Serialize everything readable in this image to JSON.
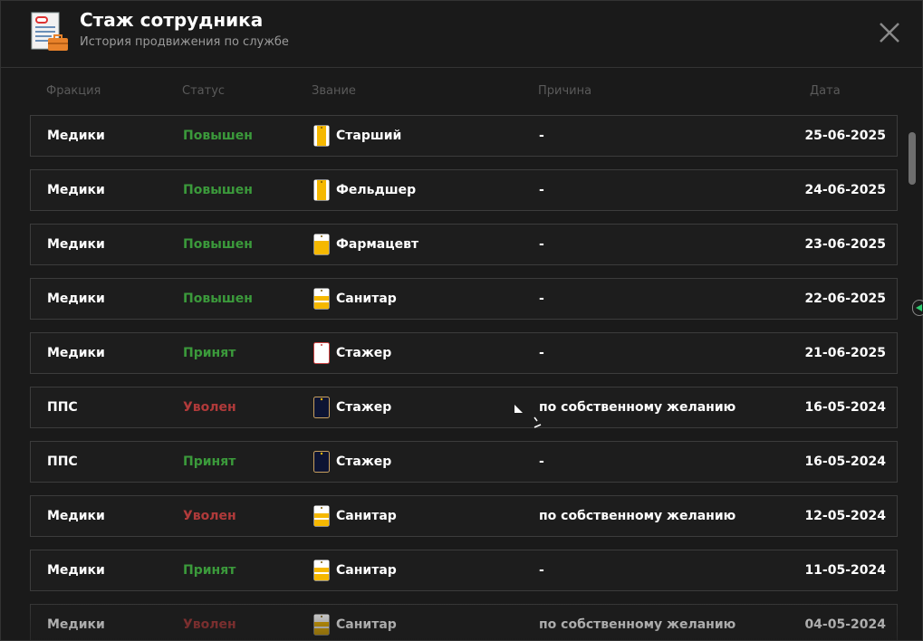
{
  "header": {
    "title": "Стаж сотрудника",
    "subtitle": "История продвижения по службе",
    "icon": "document-briefcase-icon",
    "close_icon": "close-icon"
  },
  "columns": {
    "faction": "Фракция",
    "status": "Статус",
    "rank": "Звание",
    "reason": "Причина",
    "date": "Дата"
  },
  "colors": {
    "promoted": "#3b9a3b",
    "hired": "#3b9a3b",
    "fired": "#b03a3a",
    "rank_badge_gold": "#f5b800",
    "rank_badge_navy": "#0d1433"
  },
  "rows": [
    {
      "faction": "Медики",
      "status": "Повышен",
      "status_type": "up",
      "rank": "Старший",
      "badge": "gold-tall",
      "reason": "-",
      "date": "25-06-2025"
    },
    {
      "faction": "Медики",
      "status": "Повышен",
      "status_type": "up",
      "rank": "Фельдшер",
      "badge": "gold-tall",
      "reason": "-",
      "date": "24-06-2025"
    },
    {
      "faction": "Медики",
      "status": "Повышен",
      "status_type": "up",
      "rank": "Фармацевт",
      "badge": "gold-half",
      "reason": "-",
      "date": "23-06-2025"
    },
    {
      "faction": "Медики",
      "status": "Повышен",
      "status_type": "up",
      "rank": "Санитар",
      "badge": "gold-stripes",
      "reason": "-",
      "date": "22-06-2025"
    },
    {
      "faction": "Медики",
      "status": "Принят",
      "status_type": "in",
      "rank": "Стажер",
      "badge": "white",
      "reason": "-",
      "date": "21-06-2025"
    },
    {
      "faction": "ППС",
      "status": "Уволен",
      "status_type": "out",
      "rank": "Стажер",
      "badge": "navy",
      "reason": "по собственному желанию",
      "date": "16-05-2024"
    },
    {
      "faction": "ППС",
      "status": "Принят",
      "status_type": "in",
      "rank": "Стажер",
      "badge": "navy",
      "reason": "-",
      "date": "16-05-2024"
    },
    {
      "faction": "Медики",
      "status": "Уволен",
      "status_type": "out",
      "rank": "Санитар",
      "badge": "gold-stripes",
      "reason": "по собственному желанию",
      "date": "12-05-2024"
    },
    {
      "faction": "Медики",
      "status": "Принят",
      "status_type": "in",
      "rank": "Санитар",
      "badge": "gold-stripes",
      "reason": "-",
      "date": "11-05-2024"
    },
    {
      "faction": "Медики",
      "status": "Уволен",
      "status_type": "out",
      "rank": "Санитар",
      "badge": "gold-stripes",
      "reason": "по собственному желанию",
      "date": "04-05-2024"
    }
  ]
}
